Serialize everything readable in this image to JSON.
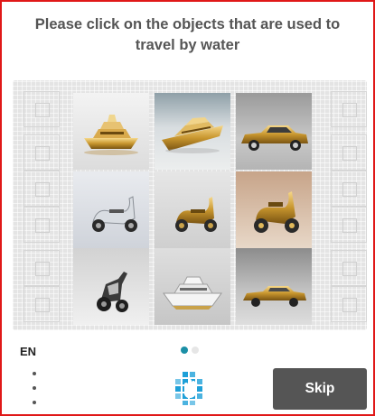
{
  "prompt": {
    "line1": "Please click on the objects that are used to",
    "line2": "travel by water"
  },
  "tiles": [
    {
      "name": "tile-golden-yacht",
      "icon": "golden-yacht-image"
    },
    {
      "name": "tile-golden-speedboat",
      "icon": "golden-speedboat-image"
    },
    {
      "name": "tile-golden-limousine",
      "icon": "golden-vintage-car-image"
    },
    {
      "name": "tile-silver-scooter",
      "icon": "silver-scooter-image"
    },
    {
      "name": "tile-golden-scooter",
      "icon": "golden-scooter-image"
    },
    {
      "name": "tile-gold-chrome-scooter",
      "icon": "gold-scooter-image"
    },
    {
      "name": "tile-black-motorbike",
      "icon": "motorbike-image"
    },
    {
      "name": "tile-white-yacht",
      "icon": "white-yacht-image"
    },
    {
      "name": "tile-gold-limousine-2",
      "icon": "gold-limousine-image"
    }
  ],
  "footer": {
    "language": "EN",
    "skip_label": "Skip",
    "page_indicator": {
      "current": 1,
      "total": 2
    }
  },
  "colors": {
    "frame_border": "#e01818",
    "prompt_text": "#555555",
    "skip_bg": "#555555",
    "dot_active": "#1b8fa6",
    "logo_blue": "#1ea0d8"
  }
}
